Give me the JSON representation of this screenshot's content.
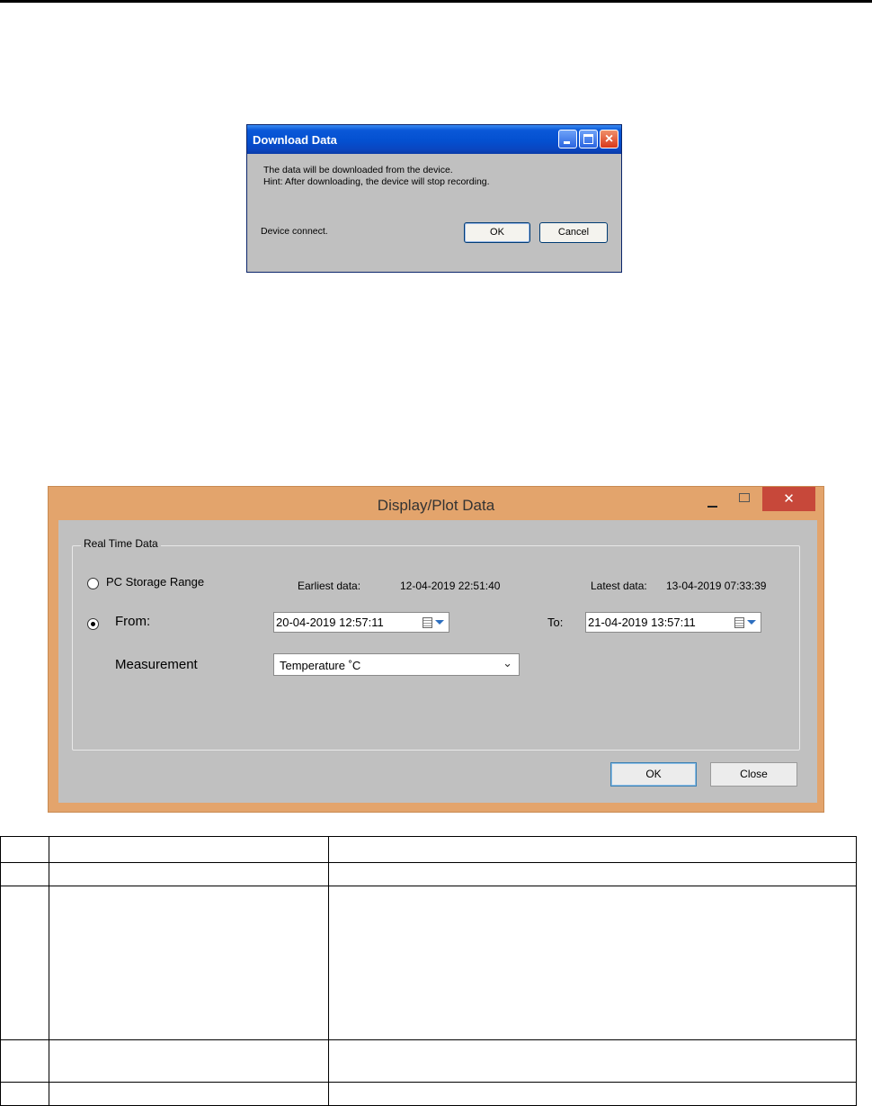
{
  "download_dialog": {
    "title": "Download Data",
    "message_line1": "The data will be downloaded from the device.",
    "message_line2": "Hint: After downloading, the device will stop recording.",
    "status": "Device connect.",
    "ok_label": "OK",
    "cancel_label": "Cancel"
  },
  "plot_dialog": {
    "title": "Display/Plot Data",
    "close_glyph": "✕",
    "group_label": "Real Time Data",
    "pc_storage_label": "PC Storage Range",
    "earliest_label": "Earliest data:",
    "earliest_value": "12-04-2019 22:51:40",
    "latest_label": "Latest data:",
    "latest_value": "13-04-2019 07:33:39",
    "from_label": "From:",
    "from_value": "20-04-2019 12:57:11",
    "to_label": "To:",
    "to_value": "21-04-2019 13:57:11",
    "measurement_label": "Measurement",
    "measurement_value": "Temperature ˚C",
    "ok_label": "OK",
    "close_label": "Close",
    "selected_range": "from"
  },
  "table": {
    "rows": [
      [
        "",
        "",
        ""
      ],
      [
        "",
        "",
        ""
      ],
      [
        "",
        "",
        ""
      ],
      [
        "",
        "",
        ""
      ],
      [
        "",
        "",
        ""
      ]
    ]
  }
}
